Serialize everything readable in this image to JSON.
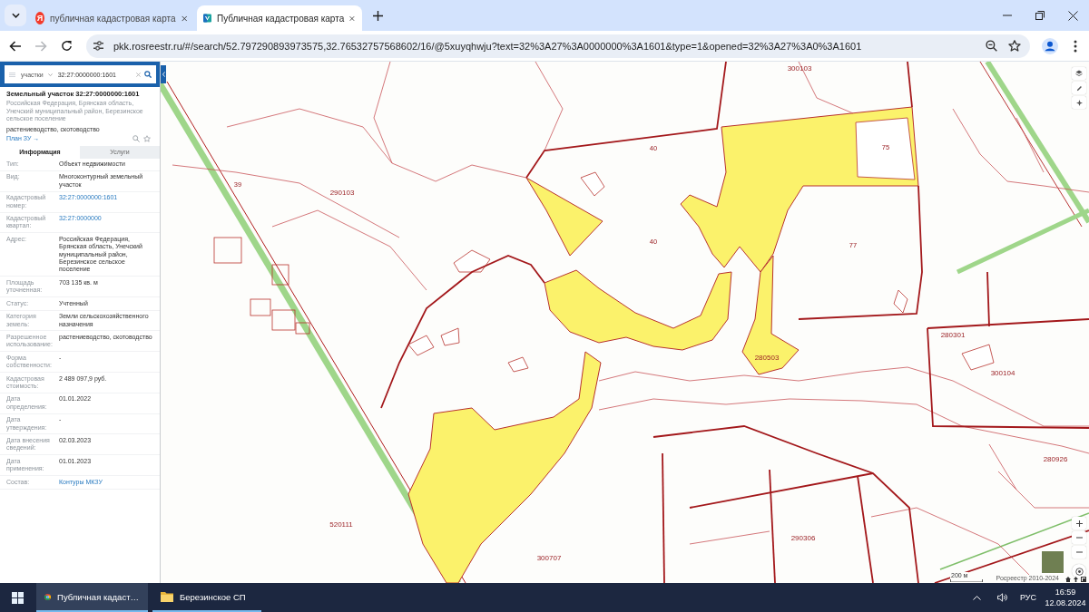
{
  "browser": {
    "tabs": [
      {
        "title": "публичная кадастровая карта",
        "icon_text": "Я",
        "kind": "yandex",
        "selected": false
      },
      {
        "title": "Публичная кадастровая карта",
        "kind": "rosreestr",
        "selected": true
      }
    ],
    "forward_button": {
      "disabled": true
    },
    "url": "pkk.rosreestr.ru/#/search/52.797290893973575,32.76532757568602/16/@5xuyqhwju?text=32%3A27%3A0000000%3A1601&type=1&opened=32%3A27%3A0%3A1601"
  },
  "search": {
    "category": "участки",
    "value": "32:27:0000000:1601"
  },
  "card": {
    "title": "Земельный участок 32:27:0000000:1601",
    "address": "Российская Федерация, Брянская область, Унечский муниципальный район, Березинское сельское поселение",
    "usage": "растениеводство, скотоводство",
    "plan_link": "План ЗУ →"
  },
  "info_tabs": [
    {
      "label": "Информация",
      "selected": true
    },
    {
      "label": "Услуги",
      "selected": false
    }
  ],
  "rows": [
    {
      "label": "Тип:",
      "value": "Объект недвижимости",
      "kind": "text"
    },
    {
      "label": "Вид:",
      "value": "Многоконтурный земельный участок",
      "kind": "text"
    },
    {
      "label": "Кадастровый номер:",
      "value": "32:27:0000000:1601",
      "kind": "link"
    },
    {
      "label": "Кадастровый квартал:",
      "value": "32:27:0000000",
      "kind": "link"
    },
    {
      "label": "Адрес:",
      "value": "Российская Федерация, Брянская область, Унечский муниципальный район, Березинское сельское поселение",
      "kind": "text"
    },
    {
      "label": "Площадь уточненная:",
      "value": "703 135 кв. м",
      "kind": "text"
    },
    {
      "label": "Статус:",
      "value": "Учтенный",
      "kind": "text"
    },
    {
      "label": "Категория земель:",
      "value": "Земли сельскохозяйственного назначения",
      "kind": "text"
    },
    {
      "label": "Разрешенное использование:",
      "value": "растениеводство, скотоводство",
      "kind": "text"
    },
    {
      "label": "Форма собственности:",
      "value": "-",
      "kind": "text"
    },
    {
      "label": "Кадастровая стоимость:",
      "value": "2 489 097,9 руб.",
      "kind": "text"
    },
    {
      "label": "Дата определения:",
      "value": "01.01.2022",
      "kind": "text"
    },
    {
      "label": "Дата утверждения:",
      "value": "-",
      "kind": "text"
    },
    {
      "label": "Дата внесения сведений:",
      "value": "02.03.2023",
      "kind": "text"
    },
    {
      "label": "Дата применения:",
      "value": "01.01.2023",
      "kind": "text"
    },
    {
      "label": "Состав:",
      "value": "Контуры МКЗУ",
      "kind": "link"
    }
  ],
  "map": {
    "labels": [
      {
        "text": "290103",
        "kind": "quarter"
      },
      {
        "text": "300103",
        "kind": "quarter"
      },
      {
        "text": "280301",
        "kind": "quarter"
      },
      {
        "text": "300104",
        "kind": "quarter"
      },
      {
        "text": "520111",
        "kind": "quarter"
      },
      {
        "text": "290306",
        "kind": "quarter"
      },
      {
        "text": "280926",
        "kind": "quarter"
      },
      {
        "text": "300707",
        "kind": "quarter"
      },
      {
        "text": "280503",
        "kind": "quarter"
      },
      {
        "text": "40",
        "kind": "parcel"
      },
      {
        "text": "40",
        "kind": "parcel"
      },
      {
        "text": "77",
        "kind": "parcel"
      },
      {
        "text": "75",
        "kind": "parcel"
      },
      {
        "text": "39",
        "kind": "parcel"
      }
    ],
    "scale": "200 м",
    "copyright": "Росреестр 2010-2024"
  },
  "taskbar": {
    "apps": [
      {
        "label": "Публичная кадаст…",
        "kind": "chrome",
        "selected": true
      },
      {
        "label": "Березинское СП",
        "kind": "folder",
        "selected": false
      }
    ],
    "language": "РУС",
    "time": "16:59",
    "date": "12.08.2024"
  }
}
